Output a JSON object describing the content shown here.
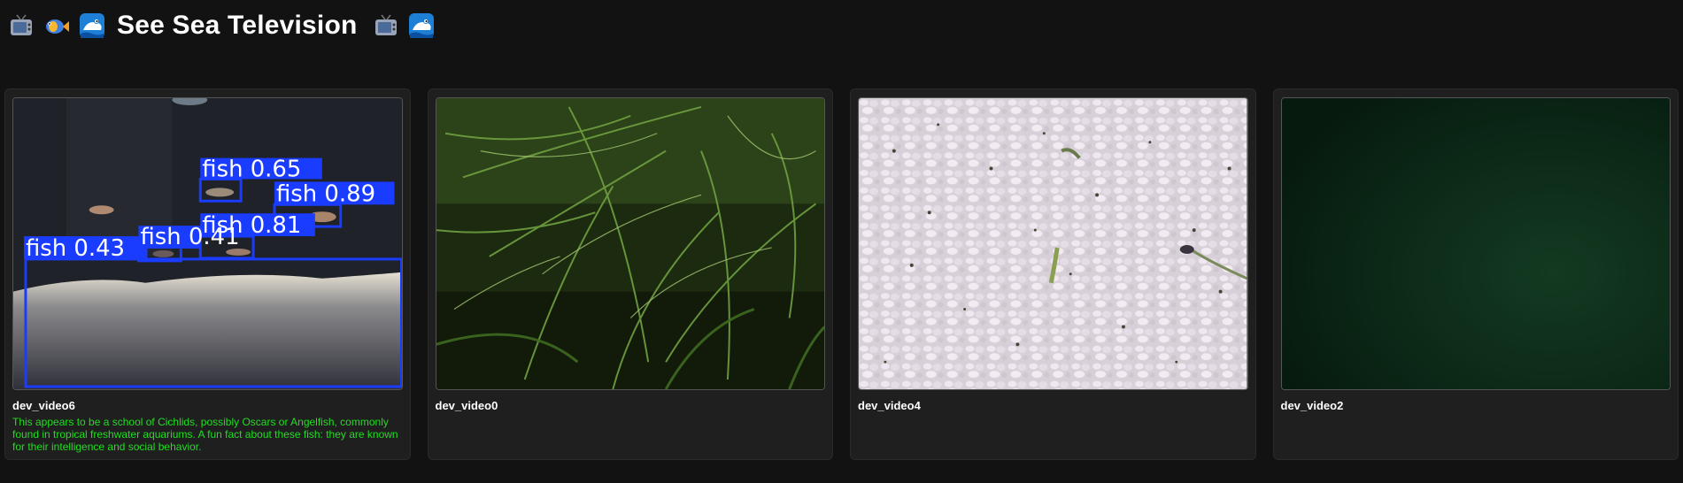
{
  "header": {
    "title": "See Sea Television",
    "left_icons": [
      "tv-icon",
      "fish-icon",
      "whale-icon"
    ],
    "right_icons": [
      "tv-icon",
      "whale-icon"
    ]
  },
  "cameras": [
    {
      "label": "dev_video6",
      "description": "This appears to be a school of Cichlids, possibly Oscars or Angelfish, commonly found in tropical freshwater aquariums. A fun fact about these fish: they are known for their intelligence and social behavior.",
      "detections": [
        "fish 0.65",
        "fish 0.89",
        "fish 0.81",
        "fish 0.43",
        "fish 0.41"
      ],
      "scene": "dark-tank"
    },
    {
      "label": "dev_video0",
      "description": "",
      "scene": "green-plants"
    },
    {
      "label": "dev_video4",
      "description": "",
      "scene": "white-gravel"
    },
    {
      "label": "dev_video2",
      "description": "",
      "scene": "dark-green"
    }
  ],
  "colors": {
    "background": "#121212",
    "card": "#1f1f1f",
    "description_text": "#22dd22",
    "detection_box": "#1a3cff"
  }
}
